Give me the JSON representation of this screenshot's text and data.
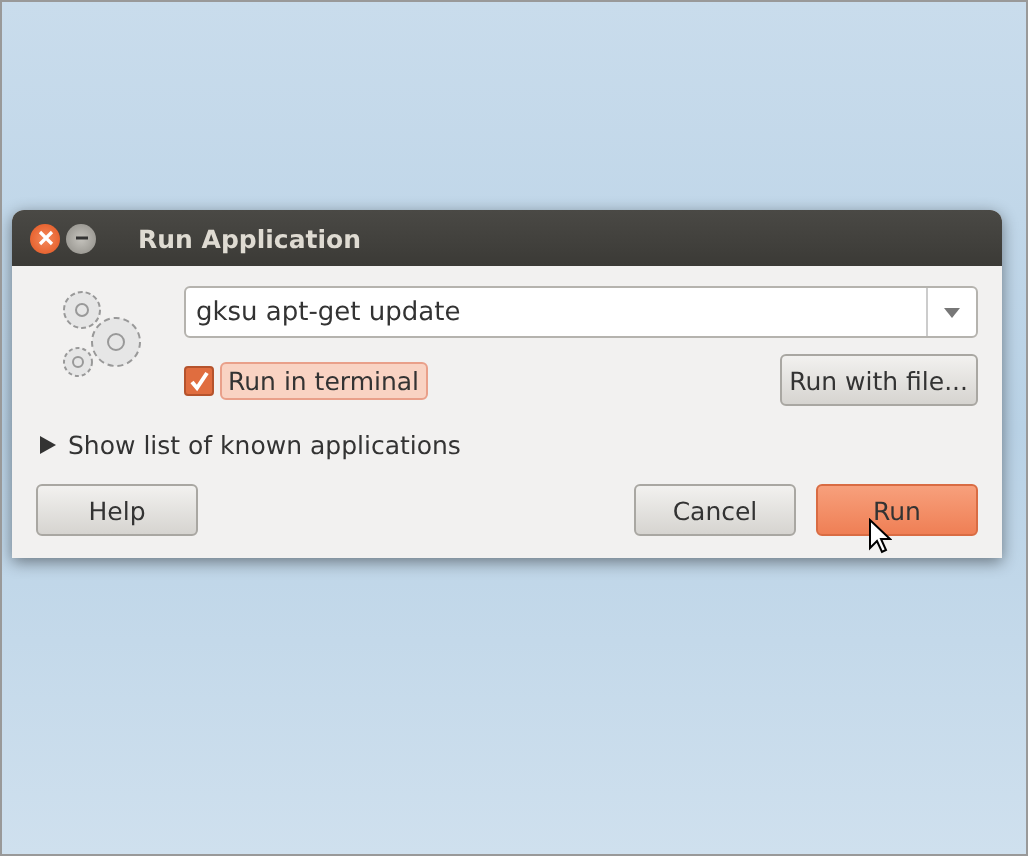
{
  "window": {
    "title": "Run Application"
  },
  "command": {
    "value": "gksu apt-get update"
  },
  "run_in_terminal": {
    "label": "Run in terminal",
    "checked": true
  },
  "run_with_file": {
    "label": "Run with file..."
  },
  "expander": {
    "label": "Show list of known applications",
    "expanded": false
  },
  "buttons": [
    {
      "label": "Help",
      "kind": "normal"
    },
    {
      "label": "Cancel",
      "kind": "normal"
    },
    {
      "label": "Run",
      "kind": "default"
    }
  ]
}
